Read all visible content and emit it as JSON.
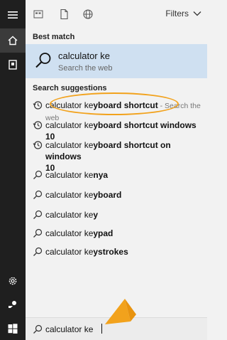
{
  "topbar": {
    "filters_label": "Filters",
    "icons": [
      "apps-icon",
      "documents-icon",
      "web-icon"
    ]
  },
  "best_match": {
    "section_label": "Best match",
    "title": "calculator ke",
    "subtitle": "Search the web"
  },
  "suggestions": {
    "section_label": "Search suggestions",
    "items": [
      {
        "prefix": "calculator ke",
        "bold": "yboard shortcut",
        "suffix": "",
        "hint": " - Search the web",
        "icon": "history-icon"
      },
      {
        "prefix": "calculator ke",
        "bold": "yboard shortcut windows 10",
        "suffix": "",
        "hint": "",
        "icon": "history-icon"
      },
      {
        "prefix": "calculator ke",
        "bold": "yboard shortcut on windows",
        "suffix": "10",
        "hint": "",
        "icon": "history-icon"
      },
      {
        "prefix": "calculator ke",
        "bold": "nya",
        "suffix": "",
        "hint": "",
        "icon": "search-icon"
      },
      {
        "prefix": "calculator ke",
        "bold": "yboard",
        "suffix": "",
        "hint": "",
        "icon": "search-icon"
      },
      {
        "prefix": "calculator ke",
        "bold": "y",
        "suffix": "",
        "hint": "",
        "icon": "search-icon"
      },
      {
        "prefix": "calculator ke",
        "bold": "ypad",
        "suffix": "",
        "hint": "",
        "icon": "search-icon"
      },
      {
        "prefix": "calculator ke",
        "bold": "ystrokes",
        "suffix": "",
        "hint": "",
        "icon": "search-icon"
      }
    ]
  },
  "search": {
    "value": "calculator ke"
  },
  "sidebar": {
    "items": [
      "hamburger-icon",
      "home-icon",
      "notebook-icon",
      "settings-icon",
      "feedback-icon",
      "windows-start-icon"
    ]
  },
  "colors": {
    "sidebar_bg": "#1f1f1f",
    "best_match_bg": "#cfe0f1",
    "annotation": "#f2a21c"
  }
}
